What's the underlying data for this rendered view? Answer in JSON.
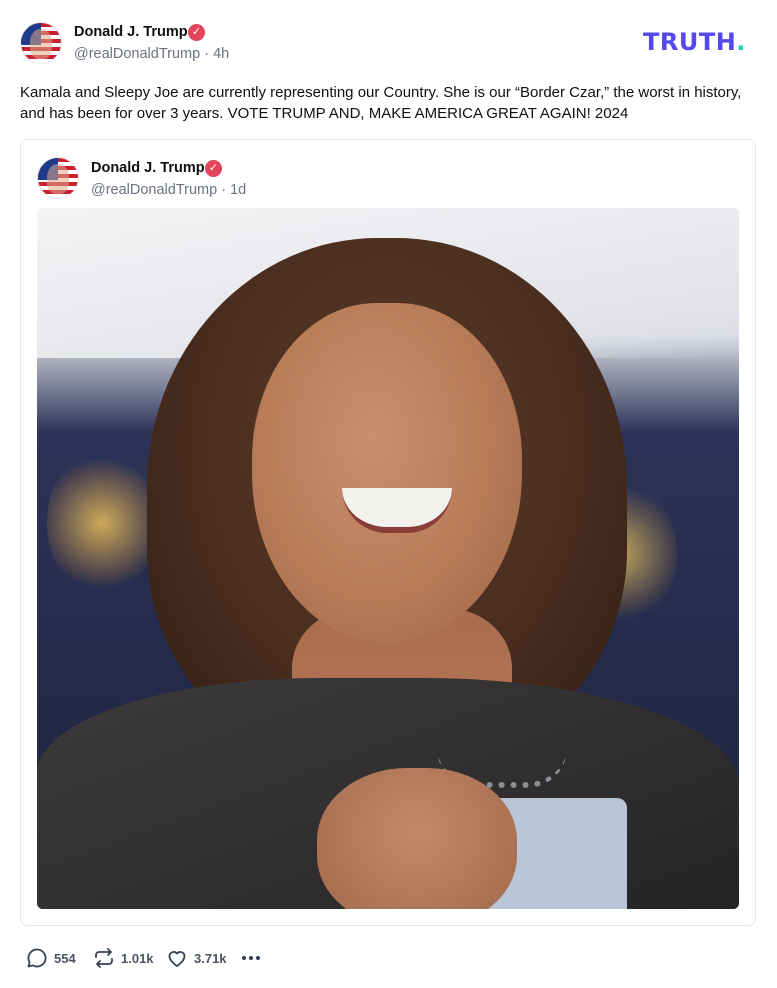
{
  "post": {
    "author": {
      "name": "Donald J. Trump",
      "verified_glyph": "✓",
      "handle": "@realDonaldTrump",
      "timestamp": "4h"
    },
    "logo": {
      "text": "TRUTH",
      "dot": ".",
      "color": "#5448ee",
      "dot_color": "#19d3b0"
    },
    "text": "Kamala and Sleepy Joe are currently representing our Country. She is our “Border Czar,” the worst in history, and has been for over 3 years. VOTE TRUMP AND, MAKE AMERICA GREAT AGAIN! 2024",
    "quoted_post": {
      "author": {
        "name": "Donald J. Trump",
        "verified_glyph": "✓",
        "handle": "@realDonaldTrump",
        "timestamp": "1d"
      },
      "image": {
        "alt_semantic": "photo-of-smiling-woman"
      }
    },
    "actions": {
      "reply": {
        "icon": "comment-icon",
        "count": "554"
      },
      "retruth": {
        "icon": "repost-icon",
        "count": "1.01k"
      },
      "like": {
        "icon": "heart-icon",
        "count": "3.71k"
      },
      "more": {
        "icon": "more-options-icon"
      }
    },
    "colors": {
      "verified_badge": "#e2445c",
      "muted_text": "#6b7280"
    }
  }
}
